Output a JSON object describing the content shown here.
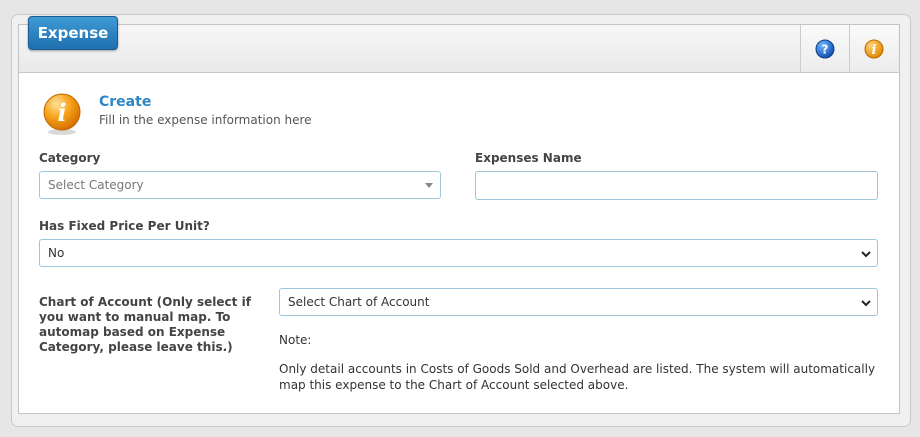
{
  "header": {
    "badge": "Expense",
    "help_icon": "question-icon",
    "info_icon": "info-icon"
  },
  "intro": {
    "title": "Create",
    "subtitle": "Fill in the expense information here"
  },
  "form": {
    "category": {
      "label": "Category",
      "value": "Select Category"
    },
    "expenses_name": {
      "label": "Expenses Name",
      "value": ""
    },
    "fixed_price": {
      "label": "Has Fixed Price Per Unit?",
      "value": "No"
    },
    "chart_of_account": {
      "label": "Chart of Account (Only select if you want to manual map. To automap based on Expense Category, please leave this.)",
      "value": "Select Chart of Account"
    },
    "note_label": "Note:",
    "note_text": "Only detail accounts in Costs of Goods Sold and Overhead are listed. The system will automatically map this expense to the Chart of Account selected above."
  },
  "colors": {
    "accent_blue": "#2f86c6",
    "badge_blue": "#1f6fae",
    "info_orange": "#f39c12",
    "field_border": "#9ec6da"
  }
}
